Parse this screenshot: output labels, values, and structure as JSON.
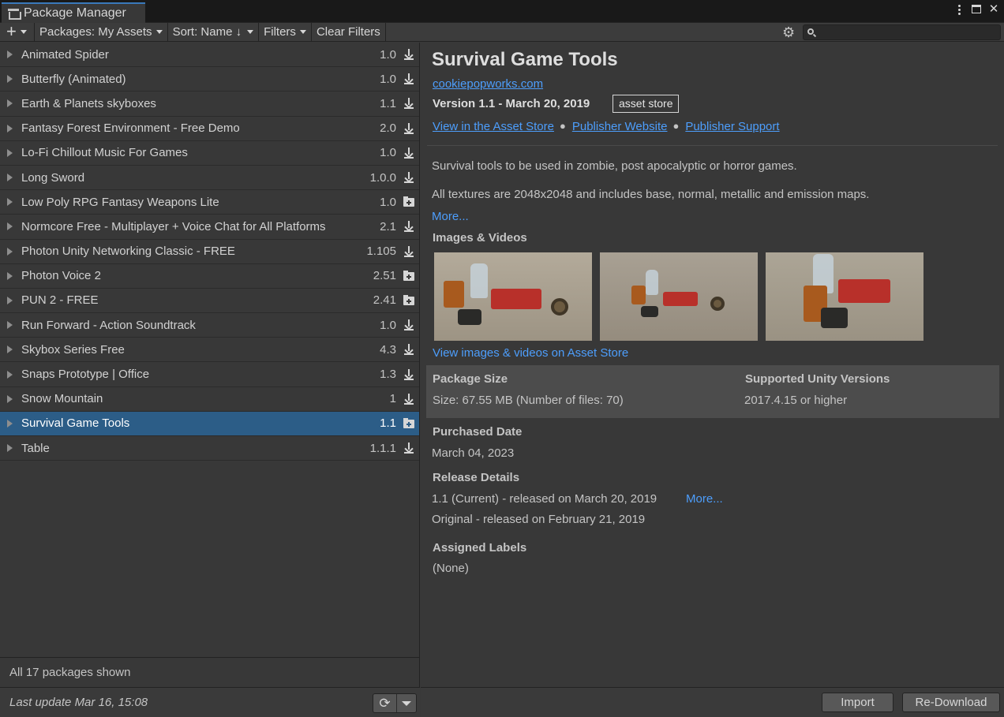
{
  "window": {
    "tab_title": "Package Manager"
  },
  "toolbar": {
    "add_label": "+",
    "packages_filter": "Packages: My Assets",
    "sort": "Sort: Name ↓",
    "filters": "Filters",
    "clear_filters": "Clear Filters",
    "search_value": ""
  },
  "packages": [
    {
      "name": "Animated Spider",
      "version": "1.0",
      "icon": "download-icon"
    },
    {
      "name": "Butterfly (Animated)",
      "version": "1.0",
      "icon": "download-icon"
    },
    {
      "name": "Earth & Planets skyboxes",
      "version": "1.1",
      "icon": "download-icon"
    },
    {
      "name": "Fantasy Forest Environment - Free Demo",
      "version": "2.0",
      "icon": "download-icon"
    },
    {
      "name": "Lo-Fi Chillout Music For Games",
      "version": "1.0",
      "icon": "download-icon"
    },
    {
      "name": "Long Sword",
      "version": "1.0.0",
      "icon": "download-icon"
    },
    {
      "name": "Low Poly RPG Fantasy Weapons Lite",
      "version": "1.0",
      "icon": "import-folder-icon"
    },
    {
      "name": "Normcore Free - Multiplayer + Voice Chat for All Platforms",
      "version": "2.1",
      "icon": "download-icon"
    },
    {
      "name": "Photon Unity Networking Classic - FREE",
      "version": "1.105",
      "icon": "download-icon"
    },
    {
      "name": "Photon Voice 2",
      "version": "2.51",
      "icon": "import-folder-icon"
    },
    {
      "name": "PUN 2 - FREE",
      "version": "2.41",
      "icon": "import-folder-icon"
    },
    {
      "name": "Run Forward - Action Soundtrack",
      "version": "1.0",
      "icon": "download-icon"
    },
    {
      "name": "Skybox Series Free",
      "version": "4.3",
      "icon": "download-icon"
    },
    {
      "name": "Snaps Prototype | Office",
      "version": "1.3",
      "icon": "download-icon"
    },
    {
      "name": "Snow Mountain",
      "version": "1",
      "icon": "download-icon"
    },
    {
      "name": "Survival Game Tools",
      "version": "1.1",
      "icon": "import-folder-icon",
      "selected": true
    },
    {
      "name": "Table",
      "version": "1.1.1",
      "icon": "download-icon"
    }
  ],
  "status": {
    "count": "All 17 packages shown",
    "last_update": "Last update Mar 16, 15:08"
  },
  "detail": {
    "title": "Survival Game Tools",
    "author": "cookiepopworks.com",
    "version": "Version 1.1 - March 20, 2019",
    "badge": "asset store",
    "links": [
      "View in the Asset Store",
      "Publisher Website",
      "Publisher Support"
    ],
    "description": [
      "Survival tools to be used in zombie, post apocalyptic or horror games.",
      "All textures are 2048x2048 and includes base, normal, metallic and emission maps."
    ],
    "more": "More...",
    "images_header": "Images & Videos",
    "images_link": "View images & videos on Asset Store",
    "package_size_header": "Package Size",
    "package_size_value": "Size: 67.55 MB (Number of files: 70)",
    "supported_header": "Supported Unity Versions",
    "supported_value": "2017.4.15 or higher",
    "purchased_header": "Purchased Date",
    "purchased_value": "March 04, 2023",
    "release_header": "Release Details",
    "release_current": "1.1 (Current) - released on March 20, 2019",
    "release_more": "More...",
    "release_original": "Original - released on February 21, 2019",
    "labels_header": "Assigned Labels",
    "labels_value": "(None)"
  },
  "footer": {
    "import": "Import",
    "redownload": "Re-Download"
  }
}
